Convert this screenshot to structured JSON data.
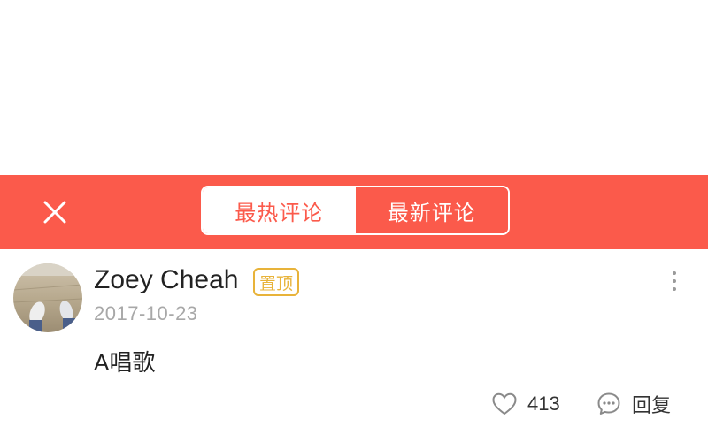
{
  "colors": {
    "accent": "#fb5a4b",
    "pin": "#e8b33a"
  },
  "header": {
    "close_icon": "close-icon",
    "tabs": [
      {
        "label": "最热评论",
        "active": true
      },
      {
        "label": "最新评论",
        "active": false
      }
    ]
  },
  "comment": {
    "author": "Zoey Cheah",
    "badge": "置顶",
    "date": "2017-10-23",
    "text": "A唱歌",
    "likes": "413",
    "reply_label": "回复",
    "icons": {
      "like": "heart-icon",
      "reply": "comment-bubble-icon",
      "more": "more-vertical-icon"
    }
  }
}
